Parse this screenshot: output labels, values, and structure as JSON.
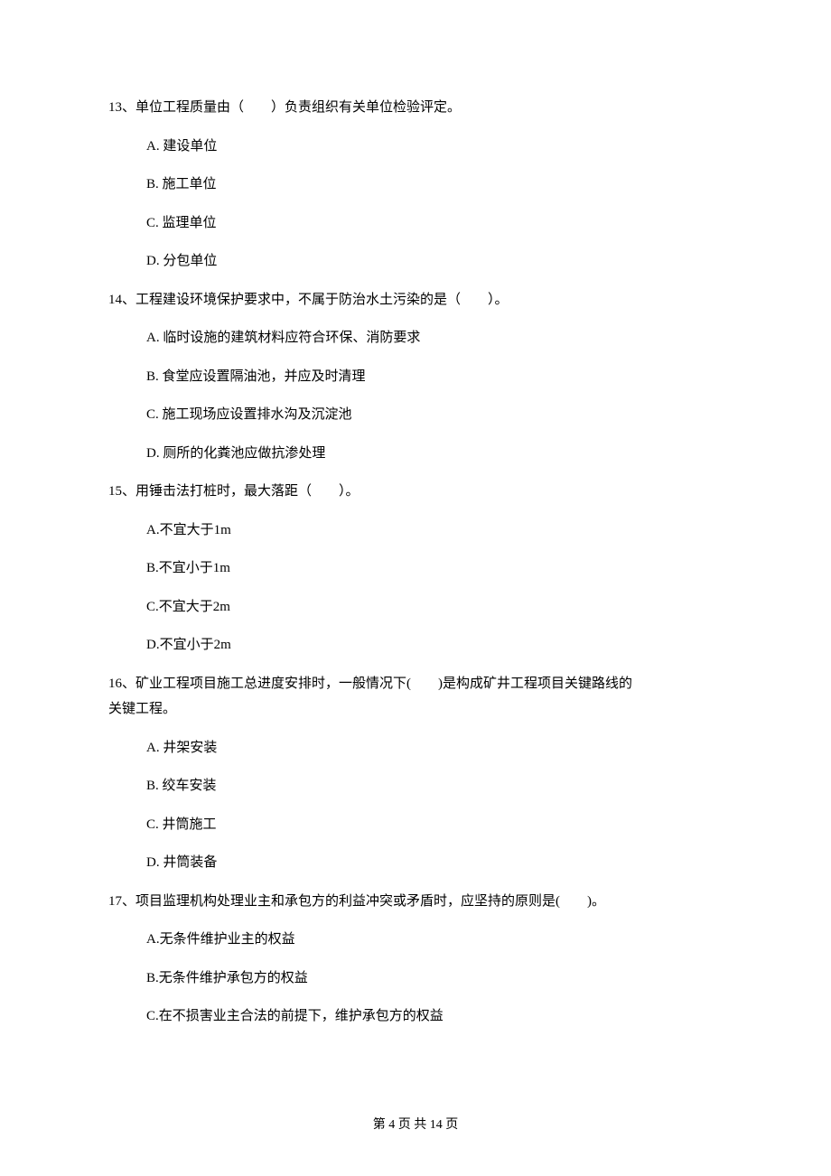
{
  "questions": [
    {
      "num": "13、",
      "stem": "单位工程质量由（　　）负责组织有关单位检验评定。",
      "opts": {
        "a": "A.  建设单位",
        "b": "B.  施工单位",
        "c": "C.  监理单位",
        "d": "D.  分包单位"
      }
    },
    {
      "num": "14、",
      "stem": "工程建设环境保护要求中，不属于防治水土污染的是（　　）。",
      "opts": {
        "a": "A.  临时设施的建筑材料应符合环保、消防要求",
        "b": "B.  食堂应设置隔油池，并应及时清理",
        "c": "C.  施工现场应设置排水沟及沉淀池",
        "d": "D.  厕所的化粪池应做抗渗处理"
      }
    },
    {
      "num": "15、",
      "stem": "用锤击法打桩时，最大落距（　　）。",
      "opts": {
        "a": "A.不宜大于1m",
        "b": "B.不宜小于1m",
        "c": "C.不宜大于2m",
        "d": "D.不宜小于2m"
      }
    },
    {
      "num": "16、",
      "stem": "矿业工程项目施工总进度安排时，一般情况下(　　)是构成矿井工程项目关键路线的",
      "stem2": "关键工程。",
      "opts": {
        "a": "A.  井架安装",
        "b": "B.  绞车安装",
        "c": "C.  井筒施工",
        "d": "D.  井筒装备"
      }
    },
    {
      "num": "17、",
      "stem": "项目监理机构处理业主和承包方的利益冲突或矛盾时，应坚持的原则是(　　)。",
      "opts": {
        "a": "A.无条件维护业主的权益",
        "b": "B.无条件维护承包方的权益",
        "c": "C.在不损害业主合法的前提下，维护承包方的权益"
      }
    }
  ],
  "footer": "第 4 页 共 14 页"
}
